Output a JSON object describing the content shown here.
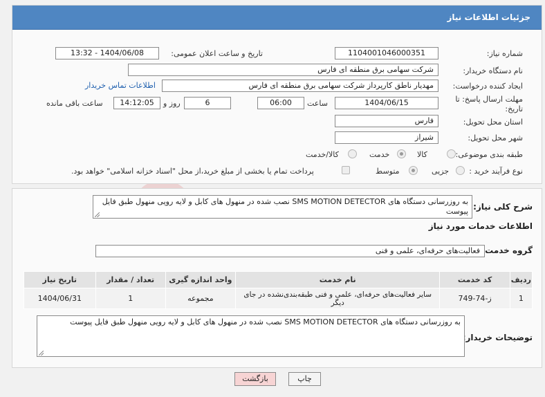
{
  "panel_title": "جزئیات اطلاعات نیاز",
  "need_number": {
    "label": "شماره نیاز:",
    "value": "1104001046000351"
  },
  "announce_datetime": {
    "label": "تاریخ و ساعت اعلان عمومی:",
    "value": "1404/06/08 - 13:32"
  },
  "buyer_org": {
    "label": "نام دستگاه خریدار:",
    "value": "شرکت سهامی برق منطقه ای فارس"
  },
  "requester": {
    "label": "ایجاد کننده درخواست:",
    "value": "مهدیار  ناطق کارپرداز شرکت سهامی برق منطقه ای فارس",
    "contact_link": "اطلاعات تماس خریدار"
  },
  "deadline": {
    "label": "مهلت ارسال پاسخ: تا تاریخ:",
    "date": "1404/06/15",
    "time_label": "ساعت",
    "time": "06:00",
    "days": "6",
    "days_label": "روز و",
    "remaining_time": "14:12:05",
    "remaining_label": "ساعت باقی مانده"
  },
  "province": {
    "label": "استان محل تحویل:",
    "value": "فارس"
  },
  "city": {
    "label": "شهر محل تحویل:",
    "value": "شیراز"
  },
  "category": {
    "label": "طبقه بندی موضوعی:",
    "options": [
      "کالا",
      "خدمت",
      "کالا/خدمت"
    ],
    "selected": "خدمت"
  },
  "purchase_type": {
    "label": "نوع فرآیند خرید :",
    "options": [
      "جزیی",
      "متوسط"
    ],
    "selected": "متوسط",
    "payment_note": "پرداخت تمام یا بخشی از مبلغ خرید،از محل \"اسناد خزانه اسلامی\" خواهد بود."
  },
  "general_desc": {
    "label": "شرح کلی نیاز:",
    "value": "به روزرسانی دستگاه های SMS MOTION DETECTOR  نصب شده در منهول های کابل و لایه رویی منهول طبق فایل پیوست"
  },
  "services_title": "اطلاعات خدمات مورد نیاز",
  "service_group": {
    "label": "گروه خدمت:",
    "value": "فعالیت‌های حرفه‌ای، علمی و فنی"
  },
  "table": {
    "headers": [
      "ردیف",
      "کد خدمت",
      "نام خدمت",
      "واحد اندازه گیری",
      "تعداد / مقدار",
      "تاریخ نیاز"
    ],
    "rows": [
      [
        "1",
        "ز-74-749",
        "سایر فعالیت‌های حرفه‌ای، علمی و فنی طبقه‌بندی‌نشده در جای دیگر",
        "مجموعه",
        "1",
        "1404/06/31"
      ]
    ]
  },
  "buyer_notes": {
    "label": "توضیحات خریدار:",
    "value": "به روزرسانی دستگاه های SMS MOTION DETECTOR  نصب شده در منهول های کابل و لایه رویی منهول طبق فایل پیوست"
  },
  "buttons": {
    "print": "چاپ",
    "back": "بازگشت"
  },
  "colors": {
    "header_blue": "#4f86c2",
    "back_button_bg": "#f7d4d4",
    "link_blue": "#1e5fae"
  }
}
